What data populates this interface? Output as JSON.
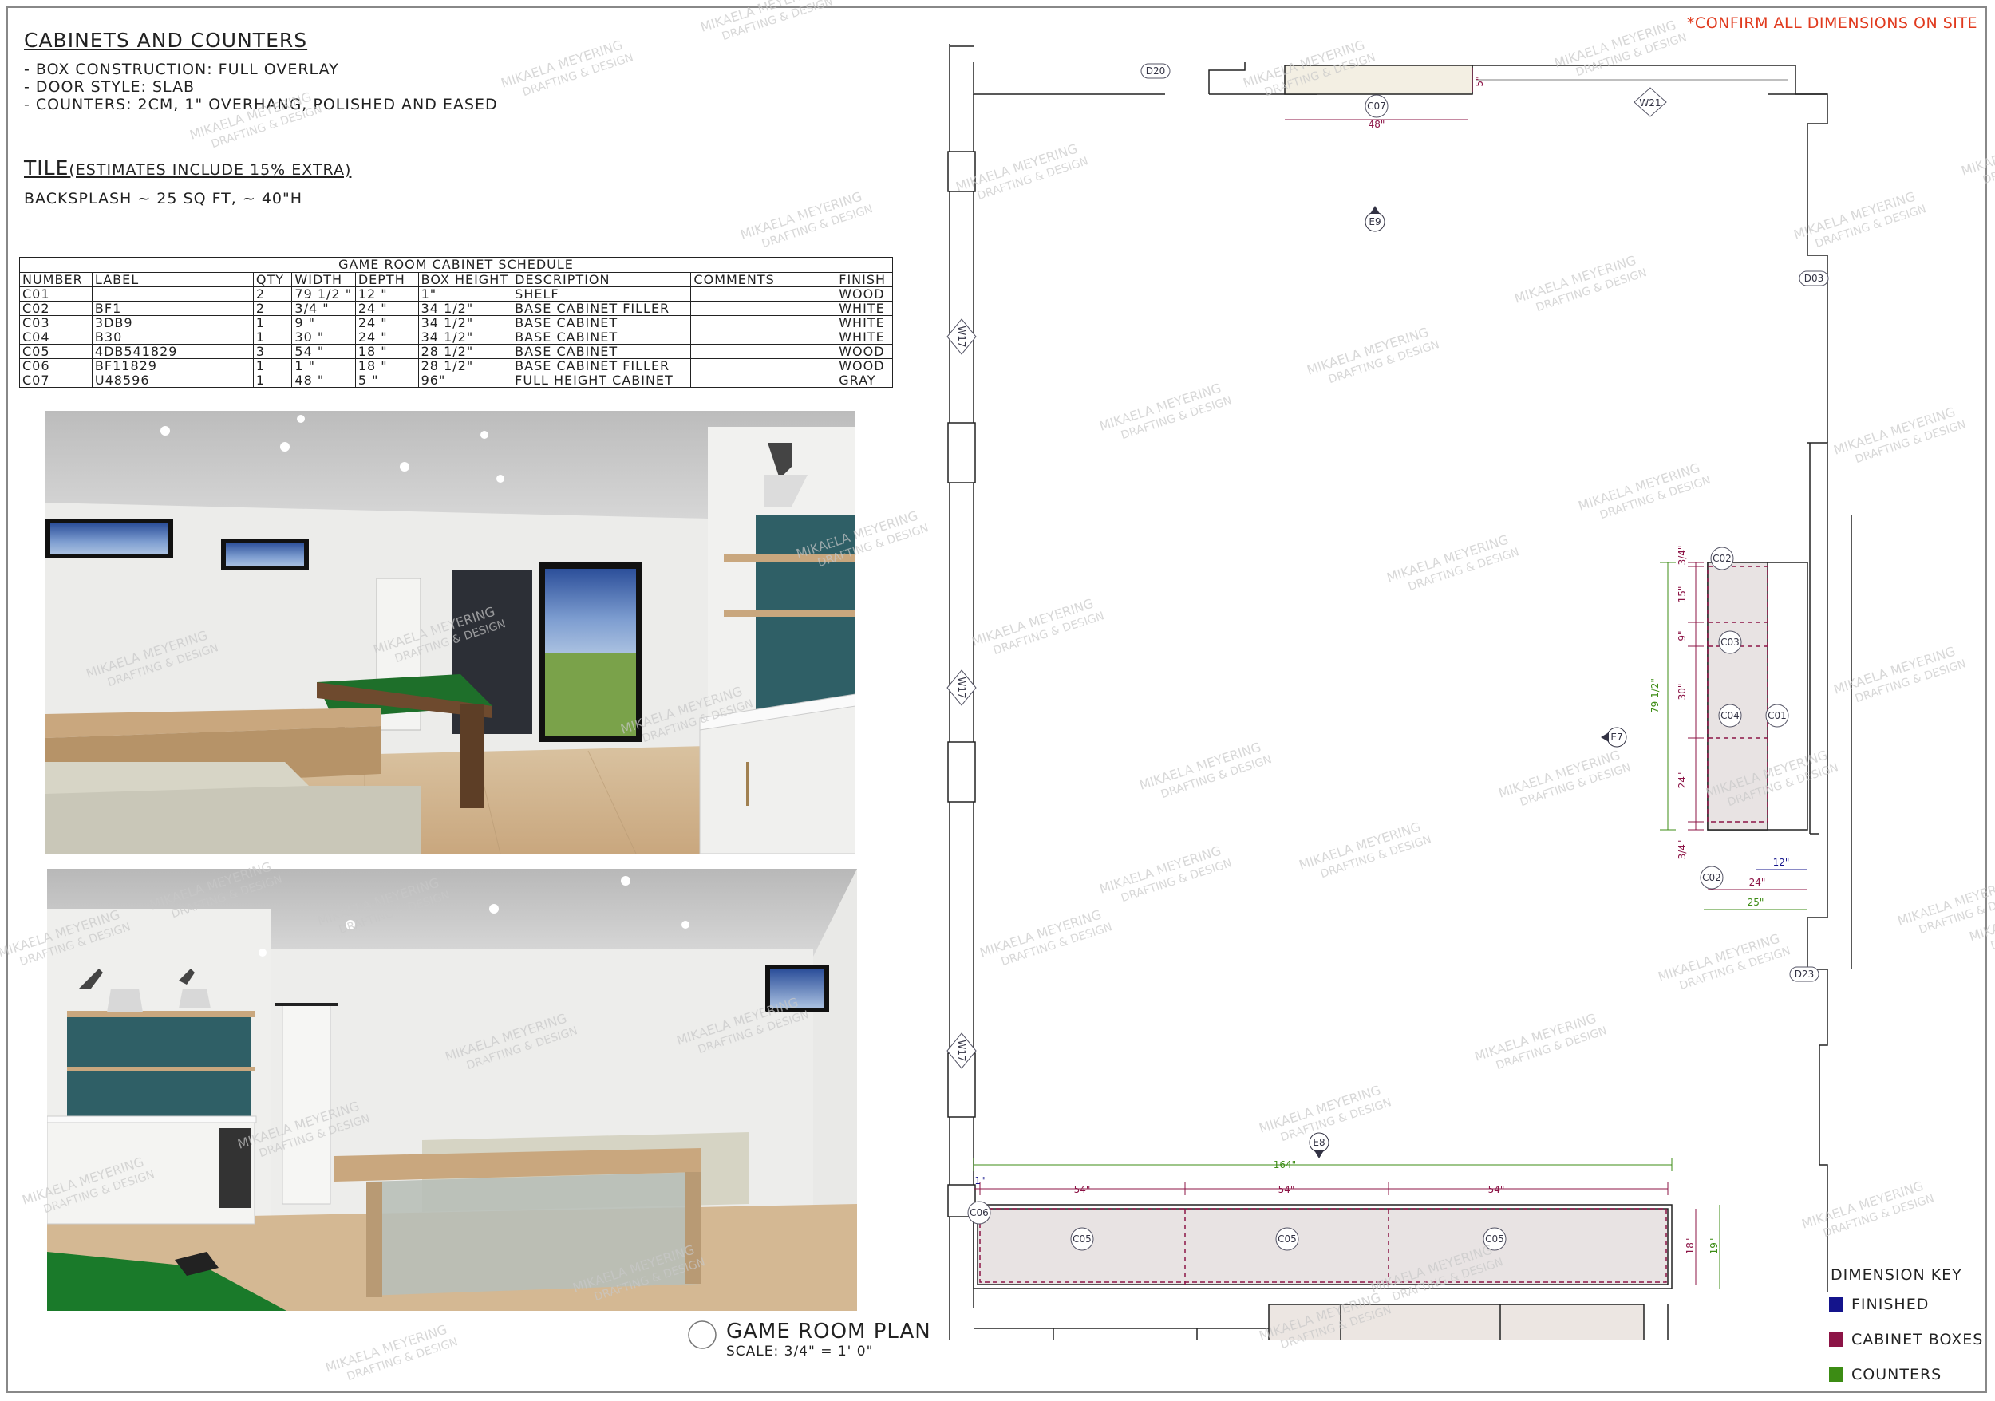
{
  "confirm_note": "*Confirm all dimensions on site",
  "cabinets": {
    "heading": "Cabinets and Counters",
    "notes": [
      "- Box construction: full overlay",
      "- Door style: slab",
      "- Counters: 2cm, 1\" overhang, polished and eased"
    ]
  },
  "tile": {
    "heading": "Tile",
    "heading_note": "(estimates include 15% extra)",
    "backsplash": "Backsplash ~ 25 sq ft, ~ 40\"H"
  },
  "schedule": {
    "caption": "Game Room Cabinet Schedule",
    "columns": [
      "Number",
      "Label",
      "Qty",
      "Width",
      "Depth",
      "Box Height",
      "Description",
      "Comments",
      "Finish"
    ],
    "rows": [
      [
        "C01",
        "",
        "2",
        "79 1/2 \"",
        "12 \"",
        "1\"",
        "Shelf",
        "",
        "Wood"
      ],
      [
        "C02",
        "BF1",
        "2",
        "3/4 \"",
        "24 \"",
        "34 1/2\"",
        "Base Cabinet Filler",
        "",
        "White"
      ],
      [
        "C03",
        "3DB9",
        "1",
        "9 \"",
        "24 \"",
        "34 1/2\"",
        "Base Cabinet",
        "",
        "White"
      ],
      [
        "C04",
        "B30",
        "1",
        "30 \"",
        "24 \"",
        "34 1/2\"",
        "Base Cabinet",
        "",
        "White"
      ],
      [
        "C05",
        "4DB541829",
        "3",
        "54 \"",
        "18 \"",
        "28 1/2\"",
        "Base Cabinet",
        "",
        "Wood"
      ],
      [
        "C06",
        "BF11829",
        "1",
        "1 \"",
        "18 \"",
        "28 1/2\"",
        "Base Cabinet Filler",
        "",
        "Wood"
      ],
      [
        "C07",
        "U48596",
        "1",
        "48 \"",
        "5 \"",
        "96\"",
        "Full Height Cabinet",
        "",
        "Gray"
      ]
    ]
  },
  "plan": {
    "title": "Game Room Plan",
    "scale": "Scale: 3/4\" = 1' 0\"",
    "tags": {
      "d20": "D20",
      "d03": "D03",
      "d23": "D23",
      "w21": "W21",
      "w17a": "W17",
      "w17b": "W17",
      "w17c": "W17",
      "e9": "E9",
      "e7": "E7",
      "e8": "E8",
      "c07": "C07",
      "c02a": "C02",
      "c02b": "C02",
      "c03": "C03",
      "c04": "C04",
      "c01": "C01",
      "c06": "C06",
      "c05a": "C05",
      "c05b": "C05",
      "c05c": "C05"
    },
    "dims": {
      "top_48": "48\"",
      "top_5": "5\"",
      "r_34a": "3/4\"",
      "r_15": "15\"",
      "r_9": "9\"",
      "r_30": "30\"",
      "r_24": "24\"",
      "r_34b": "3/4\"",
      "r_total": "79 1/2\"",
      "r_12": "12\"",
      "r_24d": "24\"",
      "r_25": "25\"",
      "b_164": "164\"",
      "b_1": "1\"",
      "b_54a": "54\"",
      "b_54b": "54\"",
      "b_54c": "54\"",
      "b_18": "18\"",
      "b_19": "19\""
    }
  },
  "dimension_key": {
    "title": "Dimension Key",
    "items": [
      {
        "label": "Finished",
        "color": "#14148c"
      },
      {
        "label": "Cabinet Boxes",
        "color": "#8c1446"
      },
      {
        "label": "Counters",
        "color": "#3c8c14"
      }
    ]
  },
  "watermark": {
    "line1": "MIKAELA MEYERING",
    "line2": "DRAFTING & DESIGN"
  }
}
